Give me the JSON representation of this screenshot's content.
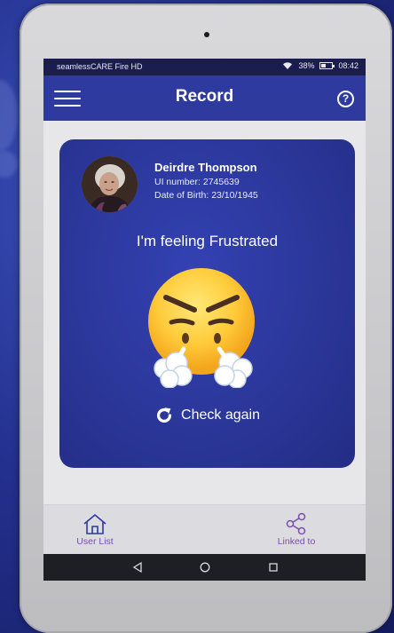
{
  "status_bar": {
    "device_name": "seamlessCARE Fire HD",
    "battery": "38%",
    "time": "08:42"
  },
  "app_bar": {
    "title": "Record",
    "help_icon": "question-circle-icon",
    "menu_icon": "hamburger-menu-icon"
  },
  "patient": {
    "name": "Deirdre Thompson",
    "ui_number": "UI number: 2745639",
    "dob": "Date of Birth: 23/10/1945"
  },
  "mood": {
    "statement": "I'm feeling Frustrated",
    "emoji": "frustrated-face-steam-icon",
    "check_again_label": "Check again"
  },
  "bottom_nav": {
    "left_label": "User List",
    "right_label": "Linked to"
  },
  "colors": {
    "app_bar": "#2e3a9e",
    "card": "#2b3799",
    "nav_label": "#7a4fa8",
    "status_bar": "#1a1d4e"
  }
}
